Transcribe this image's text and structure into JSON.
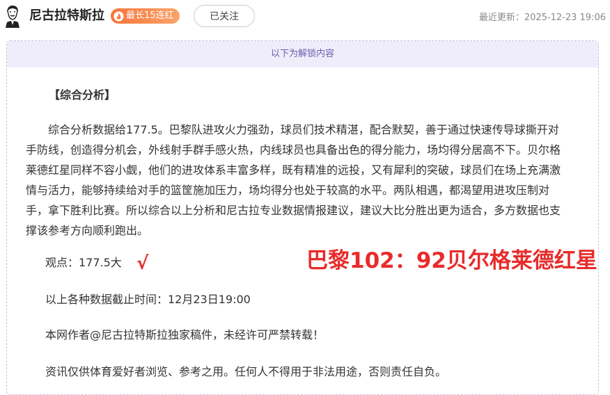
{
  "header": {
    "author_name": "尼古拉特斯拉",
    "streak_badge": "最长15连红",
    "follow_button": "已关注",
    "update_label": "最近更新：",
    "update_time": "2025-12-23 19:06"
  },
  "content": {
    "unlock_banner": "以下为解锁内容",
    "section_title": "【综合分析】",
    "analysis_paragraph": "综合分析数据给177.5。巴黎队进攻火力强劲，球员们技术精湛，配合默契，善于通过快速传导球撕开对手防线，创造得分机会，外线射手群手感火热，内线球员也具备出色的得分能力，场均得分居高不下。贝尔格莱德红星同样不容小觑，他们的进攻体系丰富多样，既有精准的远投，又有犀利的突破，球员们在场上充满激情与活力，能够持续给对手的篮筐施加压力，场均得分也处于较高的水平。两队相遇，都渴望用进攻压制对手，拿下胜利比赛。所以综合以上分析和尼古拉专业数据情报建议，建议大比分胜出更为适合，多方数据也支撑该参考方向顺利跑出。",
    "viewpoint": "观点：177.5大",
    "checkmark": "√",
    "score_overlay": "巴黎102：92贝尔格莱德红星",
    "cutoff_time": "以上各种数据截止时间：12月23日19:00",
    "copyright_notice": "本网作者@尼古拉特斯拉独家稿件，未经许可严禁转载！",
    "disclaimer": "资讯仅供体育爱好者浏览、参考之用。任何人不得用于非法用途，否则责任自负。"
  },
  "colors": {
    "accent_red": "#e82b2b",
    "badge_orange": "#f8743a",
    "banner_bg": "#efedfa",
    "banner_text": "#6a5fb0"
  },
  "icons": {
    "avatar": "tesla-portrait-avatar",
    "badge": "flame-icon"
  }
}
